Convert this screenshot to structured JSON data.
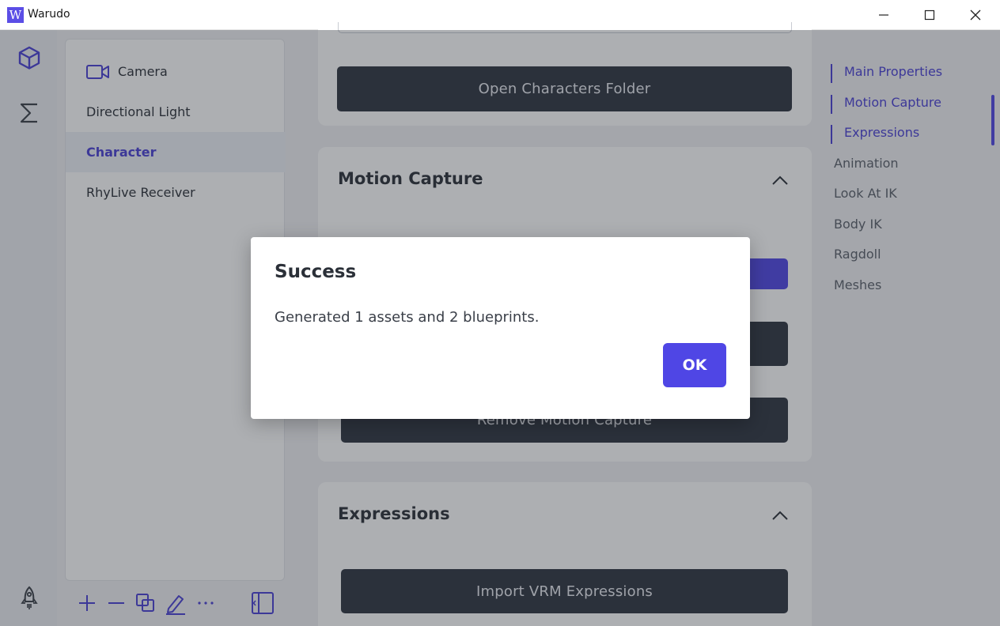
{
  "window": {
    "app_icon_letter": "W",
    "title": "Warudo"
  },
  "hierarchy": {
    "items": [
      {
        "label": "Camera"
      },
      {
        "label": "Directional Light"
      },
      {
        "label": "Character",
        "selected": true
      },
      {
        "label": "RhyLive Receiver"
      }
    ]
  },
  "main": {
    "open_characters_folder": "Open Characters Folder",
    "motion_capture": {
      "title": "Motion Capture",
      "remove_button": "Remove Motion Capture"
    },
    "expressions": {
      "title": "Expressions",
      "import_button": "Import VRM Expressions"
    }
  },
  "toc": {
    "items": [
      {
        "label": "Main Properties",
        "active": true
      },
      {
        "label": "Motion Capture",
        "active": true
      },
      {
        "label": "Expressions",
        "active": true
      },
      {
        "label": "Animation",
        "active": false
      },
      {
        "label": "Look At IK",
        "active": false
      },
      {
        "label": "Body IK",
        "active": false
      },
      {
        "label": "Ragdoll",
        "active": false
      },
      {
        "label": "Meshes",
        "active": false
      }
    ]
  },
  "dialog": {
    "title": "Success",
    "message": "Generated 1 assets and 2 blueprints.",
    "ok_label": "OK"
  },
  "colors": {
    "accent": "#4f46e5",
    "dark_button": "#2e3540",
    "overlay": "rgba(40,44,52,0.38)"
  },
  "icons": {
    "rail": [
      "cube-icon",
      "sigma-icon",
      "rocket-icon"
    ],
    "tools": [
      "plus-icon",
      "minus-icon",
      "duplicate-icon",
      "edit-icon",
      "more-icon",
      "collapse-panel-icon"
    ],
    "window": [
      "minimize-icon",
      "maximize-icon",
      "close-icon"
    ]
  }
}
